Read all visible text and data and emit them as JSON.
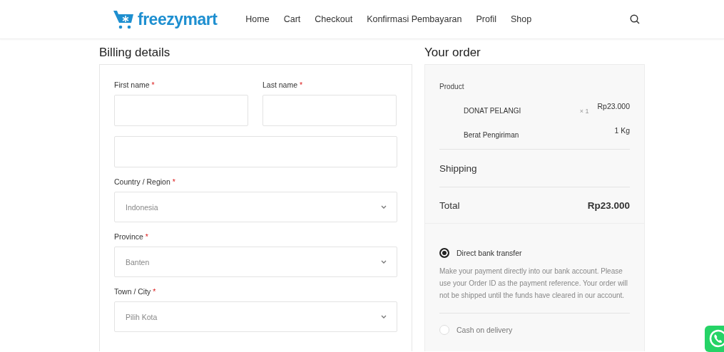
{
  "header": {
    "logo": "freezymart",
    "nav": [
      {
        "label": "Home"
      },
      {
        "label": "Cart"
      },
      {
        "label": "Checkout"
      },
      {
        "label": "Konfirmasi Pembayaran"
      },
      {
        "label": "Profil"
      },
      {
        "label": "Shop"
      }
    ]
  },
  "billing": {
    "title": "Billing details",
    "fields": [
      {
        "kind": "text",
        "label": "First name",
        "required_mark": "*",
        "half": true
      },
      {
        "kind": "text",
        "label": "Last name",
        "required_mark": "*",
        "half": true
      },
      {
        "kind": "text",
        "half": false
      },
      {
        "kind": "select",
        "label": "Country / Region",
        "required_mark": "*",
        "value": "Indonesia",
        "half": false
      },
      {
        "kind": "select",
        "label": "Province",
        "required_mark": "*",
        "value": "Banten",
        "half": false
      },
      {
        "kind": "select",
        "label": "Town / City",
        "required_mark": "*",
        "value": "Pilih Kota",
        "half": false
      }
    ]
  },
  "order": {
    "title": "Your order",
    "product_heading": "Product",
    "items": [
      {
        "name": "DONAT PELANGI",
        "qty": "× 1",
        "price": "Rp23.000"
      },
      {
        "name": "Berat Pengiriman",
        "price": "1 Kg"
      }
    ],
    "shipping": "Shipping",
    "total_label": "Total",
    "total": "Rp23.000",
    "payments": [
      {
        "label": "Direct bank transfer",
        "selected": true,
        "description": "Make your payment directly into our bank account. Please use your Order ID as the payment reference. Your order will not be shipped until the funds have cleared in our account."
      },
      {
        "label": "Cash on delivery",
        "selected": false
      }
    ]
  }
}
